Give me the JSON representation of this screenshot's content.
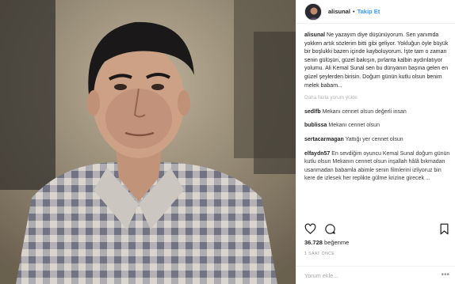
{
  "post": {
    "username": "alisunal",
    "separator": "•",
    "follow_label": "Takip Et",
    "caption": "Ne yazayım diye düşünüyorum. Sen yanımda yokken artık sözlerim bitti gibi geliyor. Yokluğun öyle büyük bir boşlukki bazen içinde kayboluyorum. İşte tam o zaman senin gülüşün, güzel bakışın, pırlanta kalbin aydınlatıyor yolumu. Ali Kemal Sunal sen bu dünyanın başına gelen en güzel şeylerden birisin. Doğum günün kutlu olsun benim melek babam...",
    "load_more": "Daha fazla yorum yükle",
    "comments": [
      {
        "user": "sedlfb",
        "text": "Mekanı cennet olsun değerli insan"
      },
      {
        "user": "bublissa",
        "text": "Mekanı cennet olsun"
      },
      {
        "user": "sertacarmagan",
        "text": "Yattığı yer cennet olsun"
      },
      {
        "user": "elfaydn57",
        "text": "En sevdiğim oyuncu Kemal Sunal doğum günün kutlu olsun Mekanın cennet olsun inşallah hâlâ bıkmadan usanmadan babamla abimle senin filmlerini izliyoruz bin kere de izlesek her replikte gülme krizine girecek ..."
      }
    ],
    "likes_count": "36.728",
    "likes_label": "beğenme",
    "time_ago": "1 SAAT ÖNCE",
    "comment_placeholder": "Yorum ekle..."
  },
  "icons": {
    "like": "heart-icon",
    "comment": "comment-bubble-icon",
    "save": "bookmark-icon",
    "options": "more-options-icon"
  },
  "colors": {
    "accent": "#3897f0",
    "text": "#262626",
    "muted": "#999999",
    "border": "#efefef"
  }
}
